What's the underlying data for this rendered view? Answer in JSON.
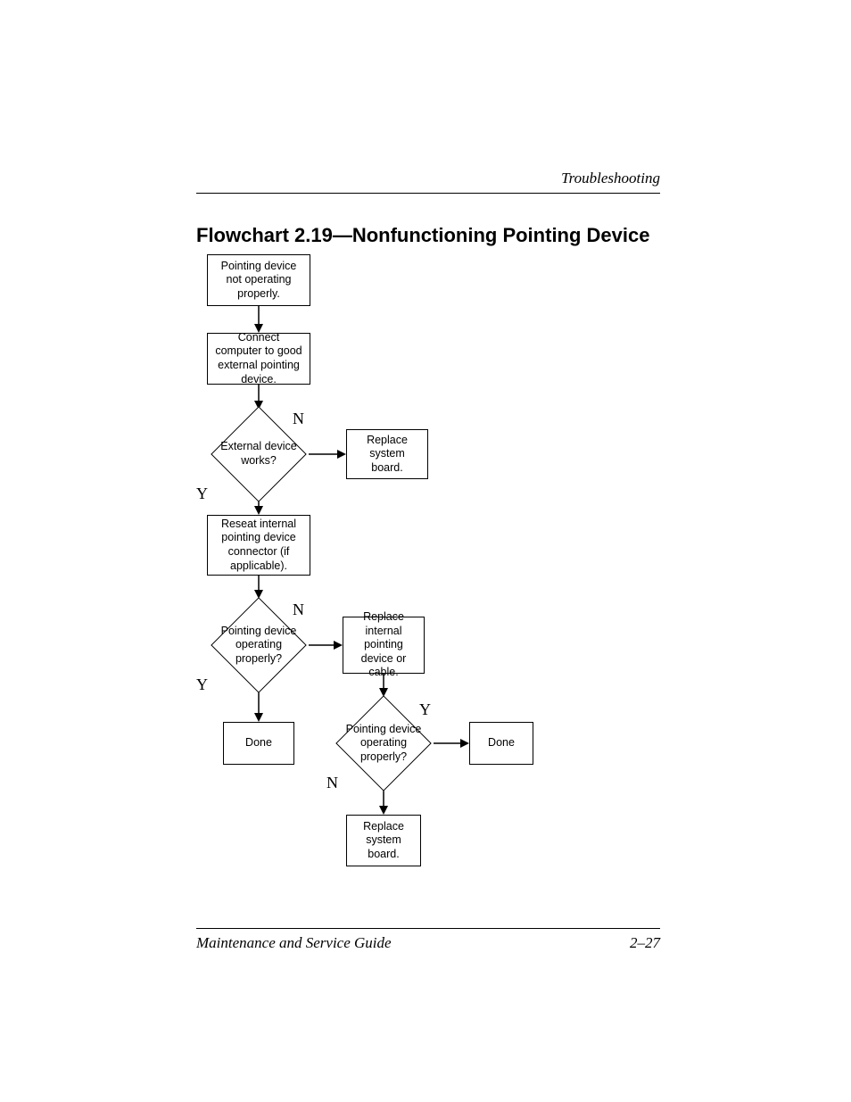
{
  "header": {
    "section": "Troubleshooting"
  },
  "title": "Flowchart 2.19—Nonfunctioning Pointing Device",
  "flow": {
    "start": "Pointing device not operating properly.",
    "step1": "Connect computer to good external pointing device.",
    "dec1": "External device works?",
    "rep_board1": "Replace system board.",
    "step2": "Reseat internal pointing device connector (if applicable).",
    "dec2": "Pointing device operating properly?",
    "done1": "Done",
    "rep_internal": "Replace internal pointing device or cable.",
    "dec3": "Pointing device operating properly?",
    "done2": "Done",
    "rep_board2": "Replace system board.",
    "yes": "Y",
    "no": "N"
  },
  "footer": {
    "left": "Maintenance and Service Guide",
    "right": "2–27"
  }
}
